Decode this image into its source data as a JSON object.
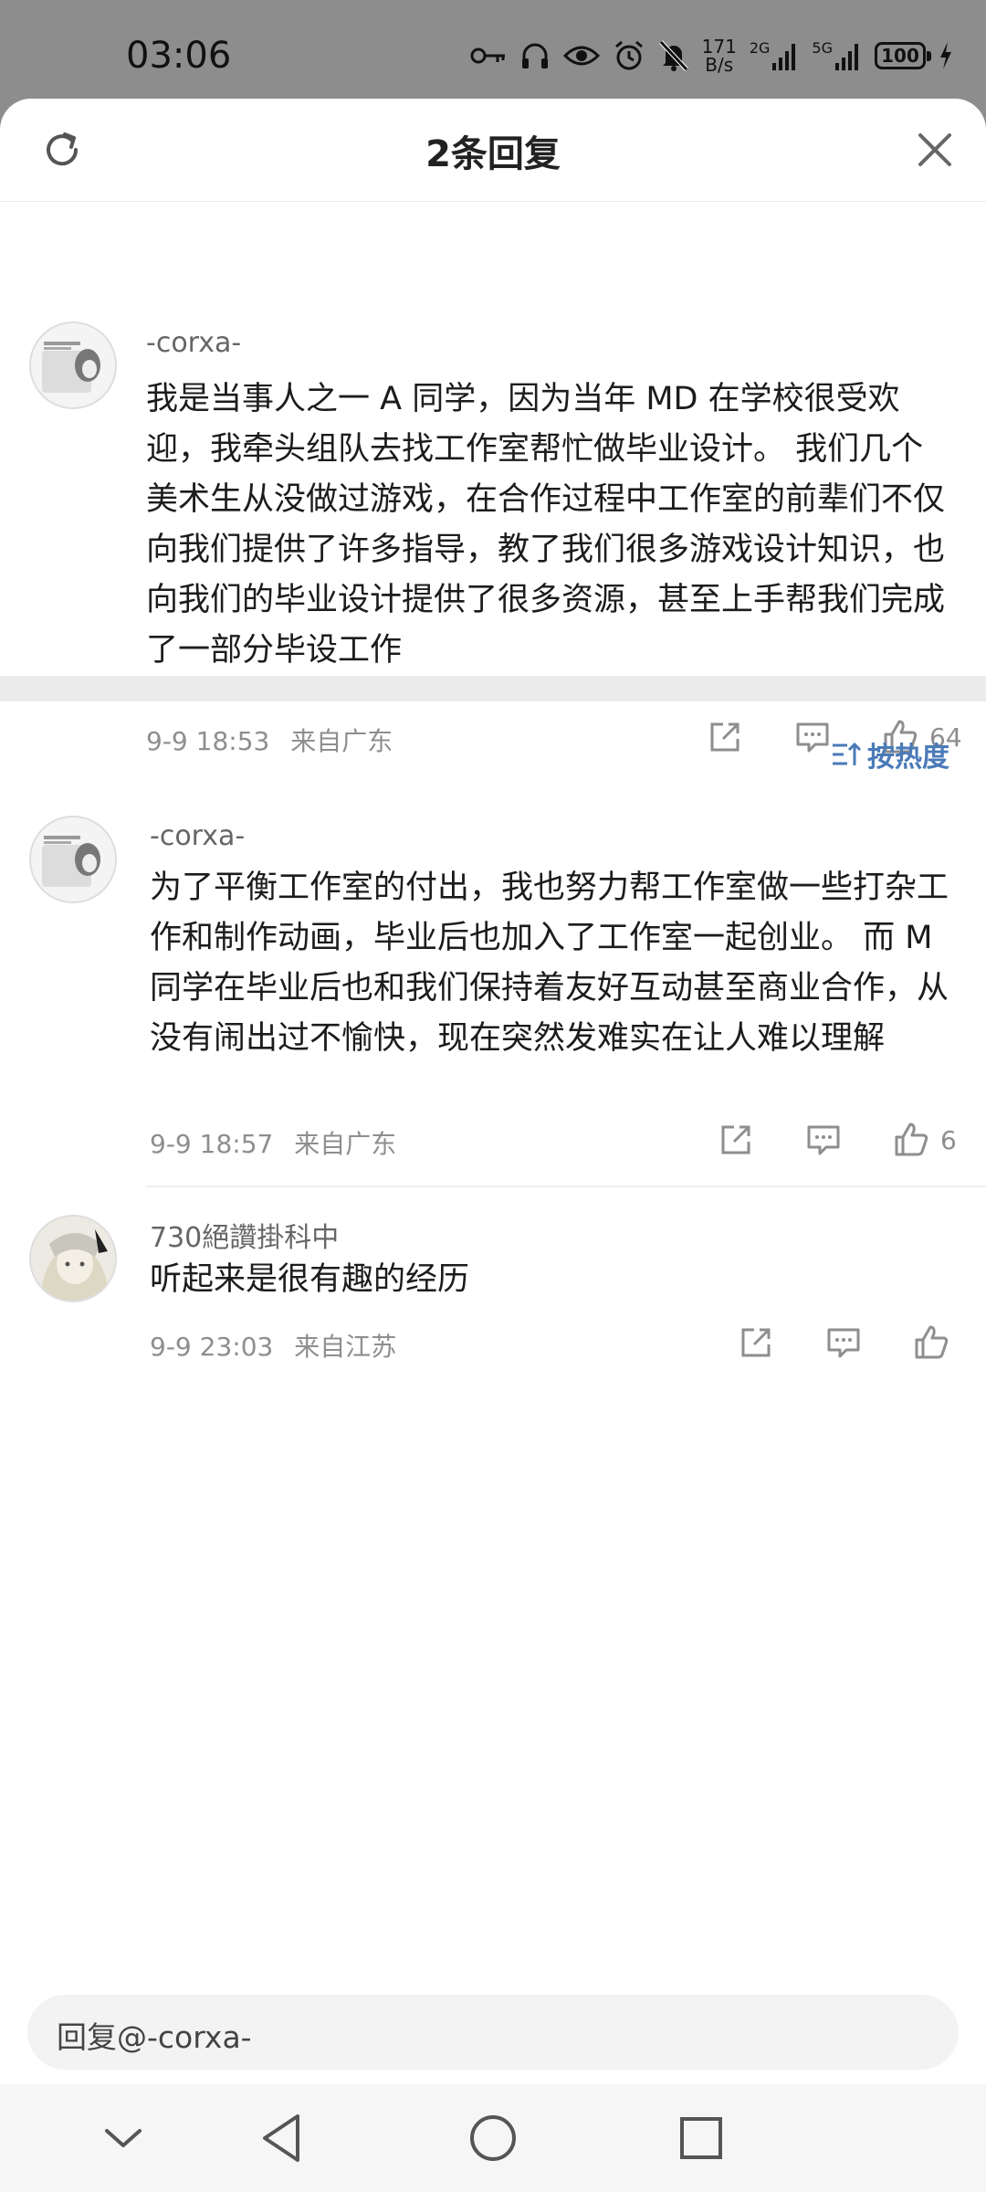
{
  "status_bar": {
    "time": "03:06",
    "net_speed_value": "171",
    "net_speed_unit": "B/s",
    "net_type_1": "2G",
    "net_type_2": "5G",
    "battery": "100"
  },
  "header": {
    "title": "2条回复",
    "refresh_icon": "refresh-icon",
    "close_icon": "close-icon"
  },
  "main_comment": {
    "username": "-corxa-",
    "text": "我是当事人之一 A 同学，因为当年 MD 在学校很受欢迎，我牵头组队去找工作室帮忙做毕业设计。 我们几个美术生从没做过游戏，在合作过程中工作室的前辈们不仅向我们提供了许多指导，教了我们很多游戏设计知识，也向我们的毕业设计提供了很多资源，甚至上手帮我们完成了一部分毕设工作",
    "date": "9-9 18:53",
    "location": "来自广东",
    "likes": "64"
  },
  "sort_label": "按热度",
  "replies": [
    {
      "username": "-corxa-",
      "text": "为了平衡工作室的付出，我也努力帮工作室做一些打杂工作和制作动画，毕业后也加入了工作室一起创业。 而 M 同学在毕业后也和我们保持着友好互动甚至商业合作，从没有闹出过不愉快，现在突然发难实在让人难以理解",
      "date": "9-9 18:57",
      "location": "来自广东",
      "likes": "6"
    },
    {
      "username": "730絕讚掛科中",
      "text": "听起来是很有趣的经历",
      "date": "9-9 23:03",
      "location": "来自江苏",
      "likes": ""
    }
  ],
  "reply_box": {
    "placeholder": "回复@-corxa-"
  },
  "colors": {
    "accent": "#4a7ab8",
    "text_primary": "#1c1c1c",
    "text_secondary": "#8e8e8e"
  }
}
